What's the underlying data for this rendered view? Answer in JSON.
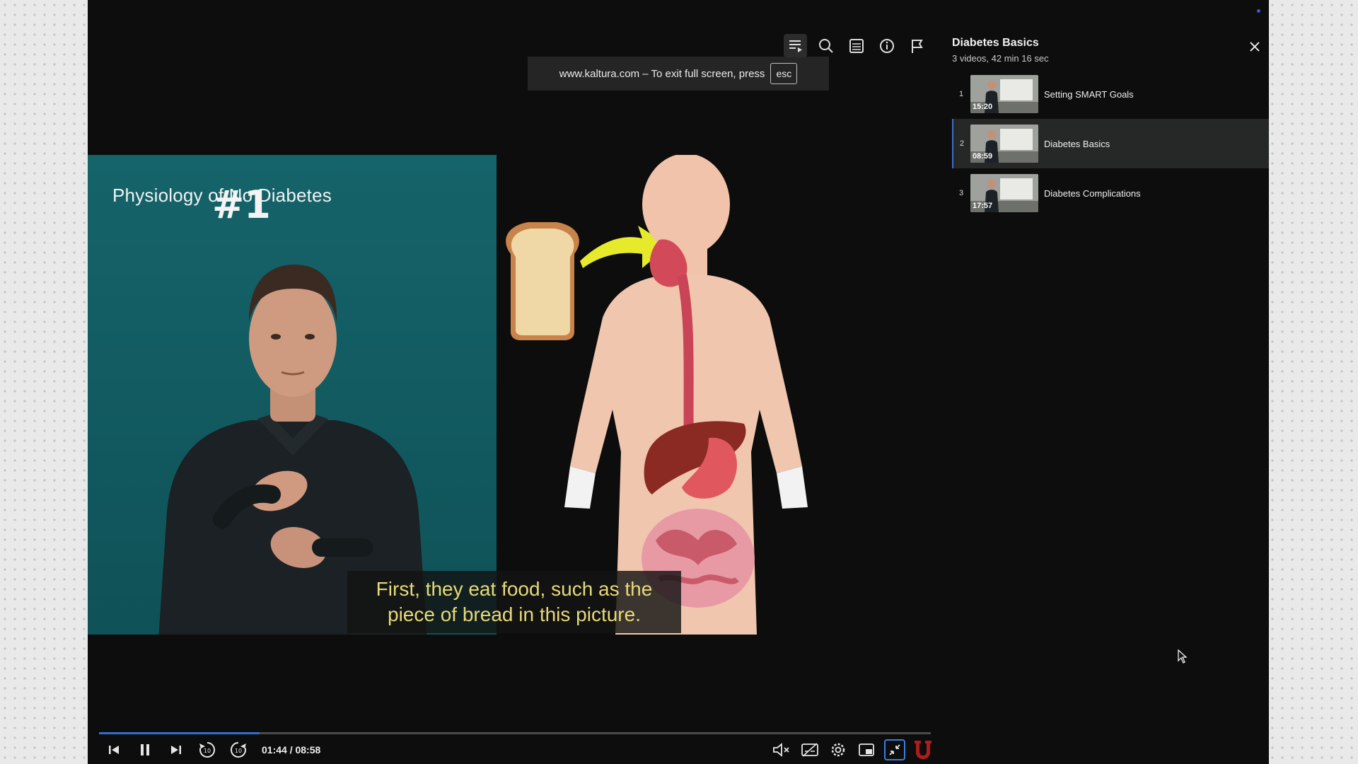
{
  "notice": {
    "text": "www.kaltura.com – To exit full screen, press",
    "key": "esc"
  },
  "slide": {
    "left_title": "Physiology of No Diabetes",
    "number": "#1"
  },
  "caption": {
    "line1": "First, they eat food, such as the",
    "line2": "piece of bread in this picture."
  },
  "toolbar": {
    "icons": [
      "playlist-icon",
      "search-icon",
      "transcript-icon",
      "info-icon",
      "flag-icon"
    ]
  },
  "player": {
    "time": "01:44 / 08:58",
    "progress_fraction": 0.193,
    "accent": "#2f6fd2"
  },
  "playlist": {
    "title": "Diabetes Basics",
    "subtitle": "3 videos, 42 min 16 sec",
    "items": [
      {
        "index": "1",
        "duration": "15:20",
        "name": "Setting SMART Goals",
        "active": false
      },
      {
        "index": "2",
        "duration": "08:59",
        "name": "Diabetes Basics",
        "active": true
      },
      {
        "index": "3",
        "duration": "17:57",
        "name": "Diabetes Complications",
        "active": false
      }
    ]
  },
  "brand": {
    "logo_color": "#b01c1c"
  }
}
